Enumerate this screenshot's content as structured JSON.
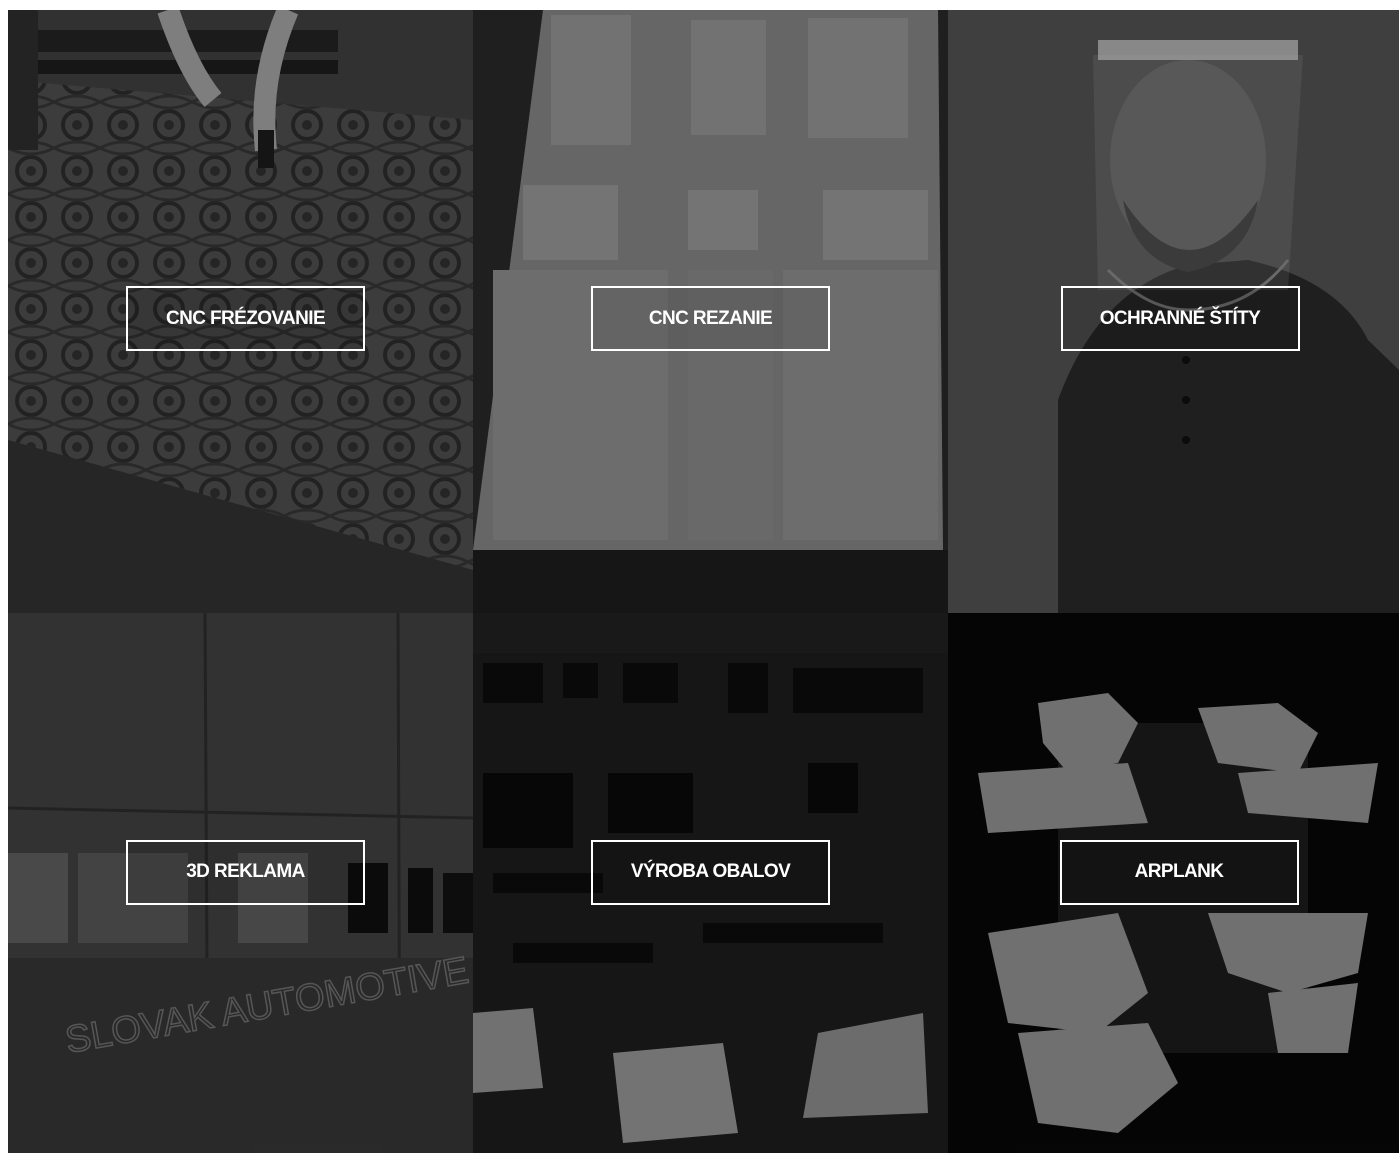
{
  "tiles": [
    {
      "label": "CNC FRÉZOVANIE",
      "image": "cnc-milling-ornament-photo"
    },
    {
      "label": "CNC REZANIE",
      "image": "cnc-cut-foam-panel-photo"
    },
    {
      "label": "OCHRANNÉ ŠTÍTY",
      "image": "man-with-face-shield-photo"
    },
    {
      "label": "3D REKLAMA",
      "image": "3d-lettering-wall-photo"
    },
    {
      "label": "VÝROBA OBALOV",
      "image": "foam-packaging-insert-photo"
    },
    {
      "label": "ARPLANK",
      "image": "foam-corner-protector-photo"
    }
  ],
  "wall_sign_text": "SLOVAK AUTOMOTIVE MARK"
}
